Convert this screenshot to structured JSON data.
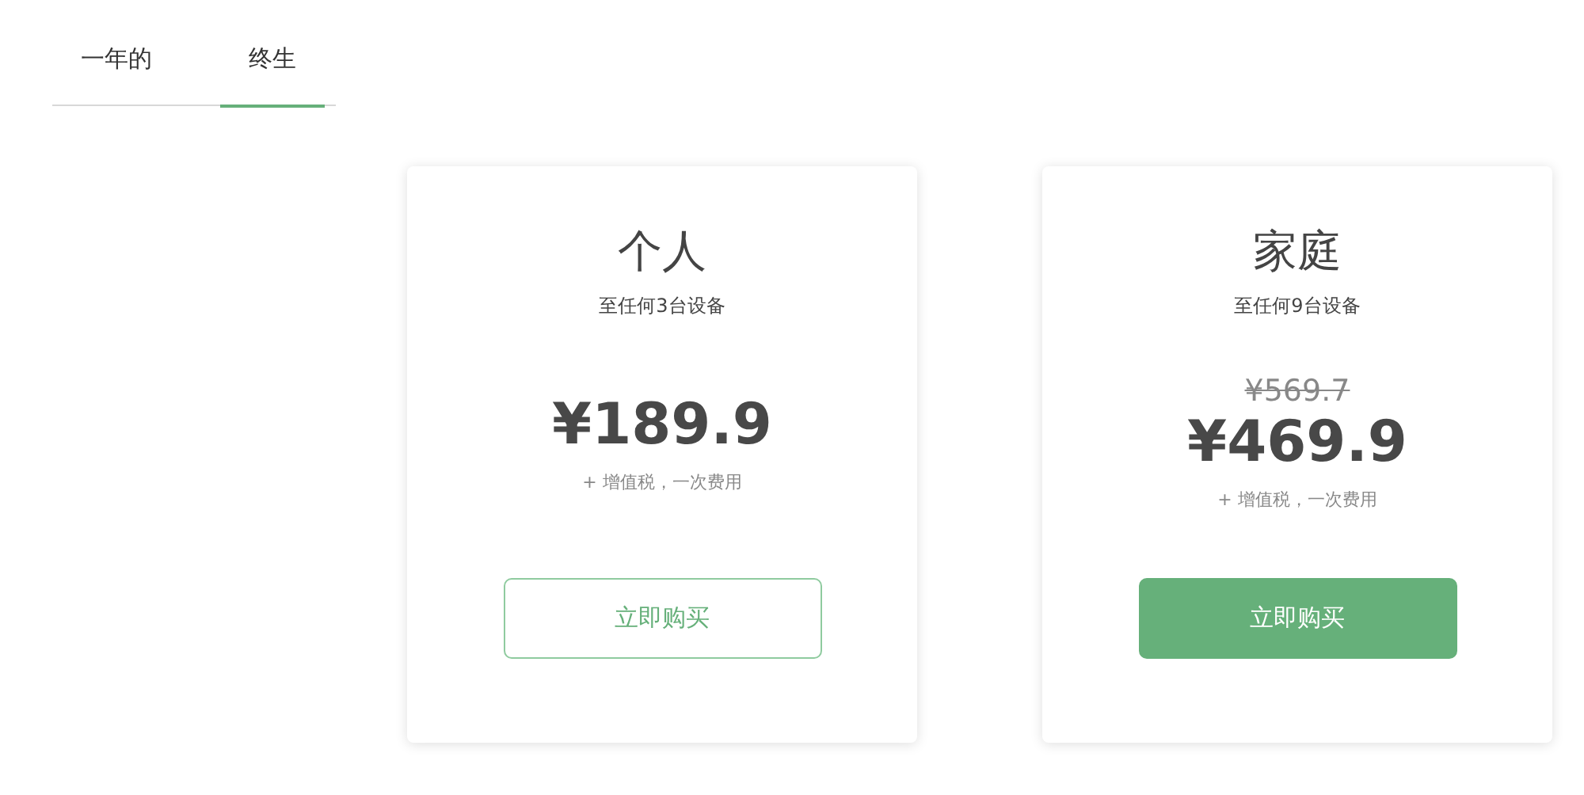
{
  "tabs": [
    {
      "label": "一年的",
      "selected": false
    },
    {
      "label": "终生",
      "selected": true
    }
  ],
  "plans": [
    {
      "name": "个人",
      "devices": "至任何3台设备",
      "price": "¥189.9",
      "note": "+ 增值税，一次费用",
      "button": {
        "label": "立即购买",
        "kind": "outline"
      }
    },
    {
      "name": "家庭",
      "devices": "至任何9台设备",
      "old_price": "¥569.7",
      "price": "¥469.9",
      "note": "+ 增值税，一次费用",
      "button": {
        "label": "立即购买",
        "kind": "filled"
      }
    }
  ]
}
